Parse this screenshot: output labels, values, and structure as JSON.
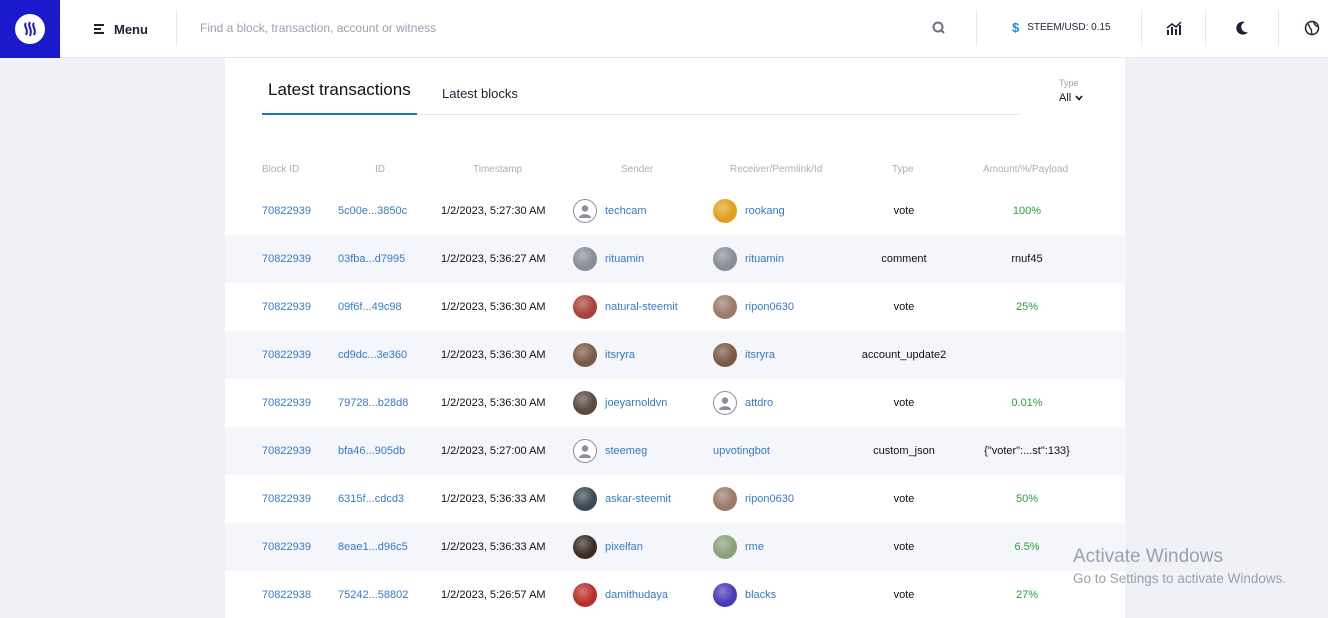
{
  "header": {
    "menu_label": "Menu",
    "search_placeholder": "Find a block, transaction, account or witness",
    "price_label": "STEEM/USD: 0.15",
    "price_symbol": "$"
  },
  "tabs": {
    "active": "Latest transactions",
    "other": "Latest blocks"
  },
  "filter": {
    "label": "Type",
    "value": "All"
  },
  "table": {
    "columns": [
      "Block ID",
      "ID",
      "Timestamp",
      "Sender",
      "Receiver/Permlink/Id",
      "Type",
      "Amount/%/Payload"
    ],
    "rows": [
      {
        "block": "70822939",
        "id": "5c00e...3850c",
        "timestamp": "1/2/2023, 5:27:30 AM",
        "sender": "techcam",
        "sender_avatar": "#ffffff",
        "receiver": "rookang",
        "receiver_avatar": "#e0a020",
        "type": "vote",
        "amount": "100%",
        "amount_kind": "pct"
      },
      {
        "block": "70822939",
        "id": "03fba...d7995",
        "timestamp": "1/2/2023, 5:36:27 AM",
        "sender": "rituamin",
        "sender_avatar": "#8a8d96",
        "receiver": "rituamin",
        "receiver_avatar": "#8a8d96",
        "type": "comment",
        "amount": "rnuf45",
        "amount_kind": "text"
      },
      {
        "block": "70822939",
        "id": "09f6f...49c98",
        "timestamp": "1/2/2023, 5:36:30 AM",
        "sender": "natural-steemit",
        "sender_avatar": "#a8403a",
        "receiver": "ripon0630",
        "receiver_avatar": "#9a7a6a",
        "type": "vote",
        "amount": "25%",
        "amount_kind": "pct"
      },
      {
        "block": "70822939",
        "id": "cd9dc...3e360",
        "timestamp": "1/2/2023, 5:36:30 AM",
        "sender": "itsryra",
        "sender_avatar": "#7a5a44",
        "receiver": "itsryra",
        "receiver_avatar": "#7a5a44",
        "type": "account_update2",
        "amount": "",
        "amount_kind": "text"
      },
      {
        "block": "70822939",
        "id": "79728...b28d8",
        "timestamp": "1/2/2023, 5:36:30 AM",
        "sender": "joeyarnoldvn",
        "sender_avatar": "#5a4a40",
        "receiver": "attdro",
        "receiver_avatar": "#ffffff",
        "type": "vote",
        "amount": "0.01%",
        "amount_kind": "pct"
      },
      {
        "block": "70822939",
        "id": "bfa46...905db",
        "timestamp": "1/2/2023, 5:27:00 AM",
        "sender": "steemeg",
        "sender_avatar": "#ffffff",
        "receiver": "upvotingbot",
        "receiver_avatar": "",
        "type": "custom_json",
        "amount": "{\"voter\":...st\":133}",
        "amount_kind": "text"
      },
      {
        "block": "70822939",
        "id": "6315f...cdcd3",
        "timestamp": "1/2/2023, 5:36:33 AM",
        "sender": "askar-steemit",
        "sender_avatar": "#3a4a55",
        "receiver": "ripon0630",
        "receiver_avatar": "#9a7a6a",
        "type": "vote",
        "amount": "50%",
        "amount_kind": "pct"
      },
      {
        "block": "70822939",
        "id": "8eae1...d96c5",
        "timestamp": "1/2/2023, 5:36:33 AM",
        "sender": "pixelfan",
        "sender_avatar": "#3a2a22",
        "receiver": "rme",
        "receiver_avatar": "#8aa07a",
        "type": "vote",
        "amount": "6.5%",
        "amount_kind": "pct"
      },
      {
        "block": "70822938",
        "id": "75242...58802",
        "timestamp": "1/2/2023, 5:26:57 AM",
        "sender": "damithudaya",
        "sender_avatar": "#b8302a",
        "receiver": "blacks",
        "receiver_avatar": "#4a3ab8",
        "type": "vote",
        "amount": "27%",
        "amount_kind": "pct"
      }
    ]
  },
  "watermark": {
    "title": "Activate Windows",
    "subtitle": "Go to Settings to activate Windows."
  },
  "colors": {
    "brand": "#1a1acc",
    "link": "#3978c9",
    "positive": "#2e9e3c",
    "tab_underline": "#1a73c8"
  }
}
